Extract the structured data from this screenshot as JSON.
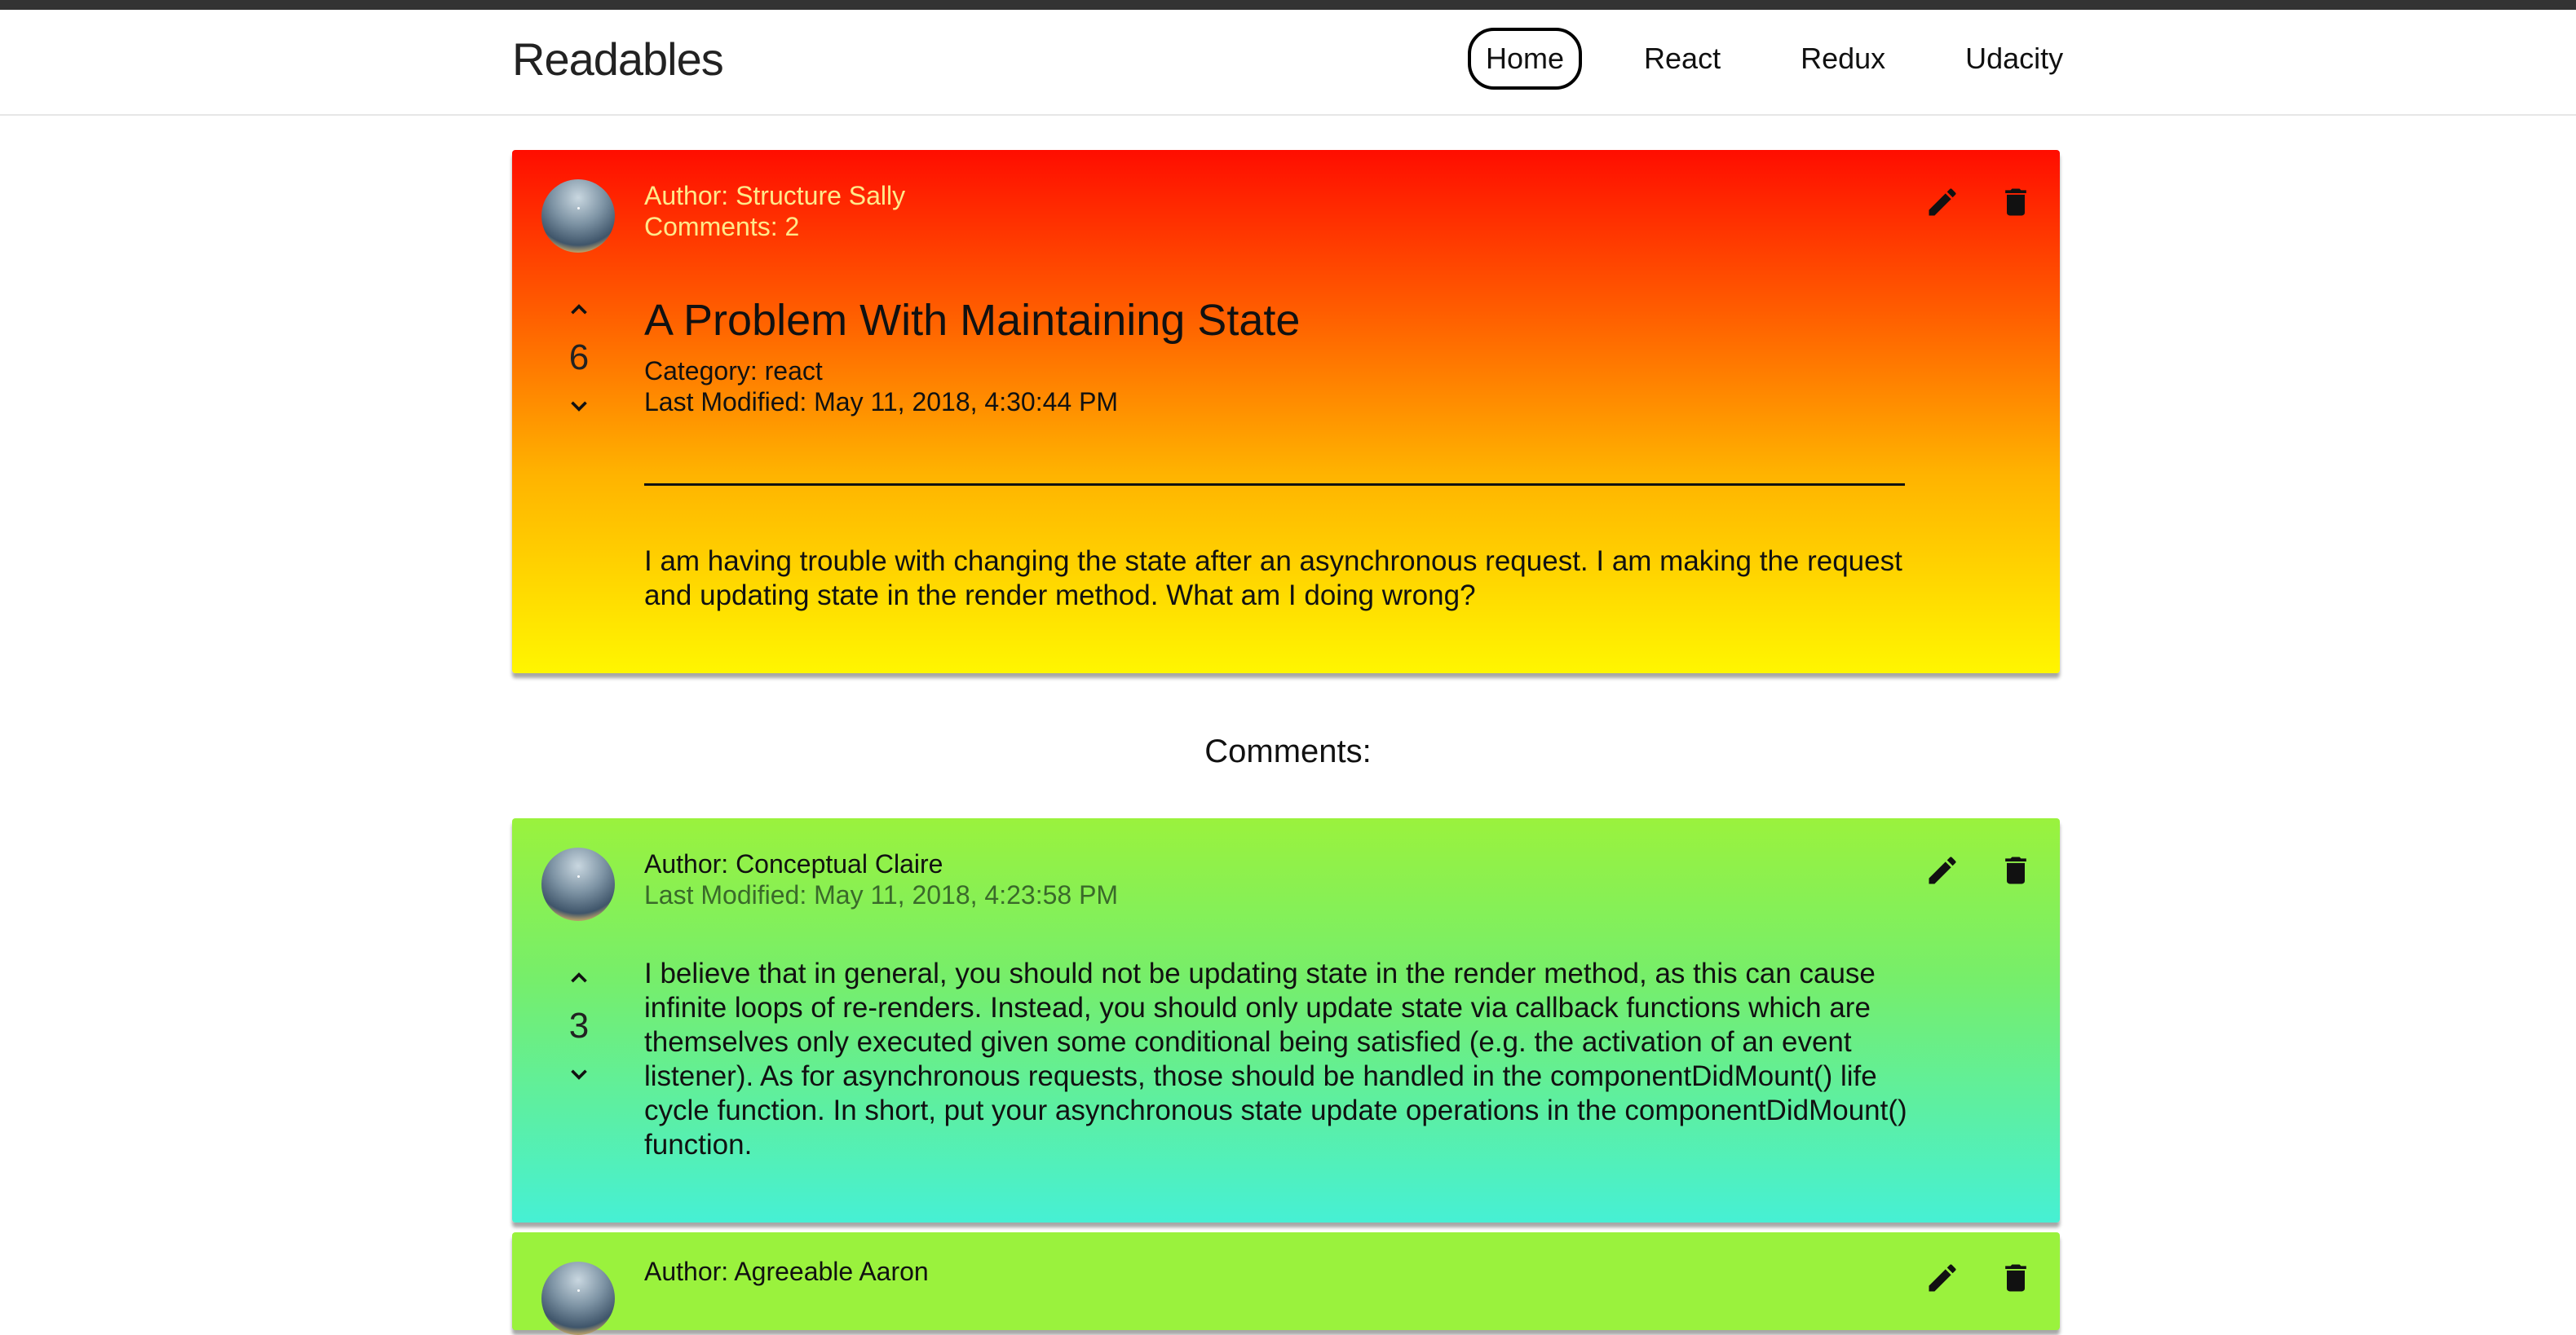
{
  "header": {
    "brand": "Readables",
    "nav": [
      {
        "label": "Home",
        "active": true
      },
      {
        "label": "React",
        "active": false
      },
      {
        "label": "Redux",
        "active": false
      },
      {
        "label": "Udacity",
        "active": false
      }
    ]
  },
  "post": {
    "author": "Author: Structure Sally",
    "comments_count": "Comments: 2",
    "score": "6",
    "title": "A Problem With Maintaining State",
    "category": "Category: react",
    "last_modified": "Last Modified: May 11, 2018, 4:30:44 PM",
    "body": "I am having trouble with changing the state after an asynchronous request. I am making the request and updating state in the render method. What am I doing wrong?"
  },
  "comments_heading": "Comments:",
  "comments": [
    {
      "author": "Author: Conceptual Claire",
      "last_modified": "Last Modified: May 11, 2018, 4:23:58 PM",
      "score": "3",
      "body": "I believe that in general, you should not be updating state in the render method, as this can cause infinite loops of re-renders. Instead, you should only update state via callback functions which are themselves only executed given some conditional being satisfied (e.g. the activation of an event listener). As for asynchronous requests, those should be handled in the componentDidMount() life cycle function. In short, put your asynchronous state update operations in the componentDidMount() function."
    },
    {
      "author": "Author: Agreeable Aaron"
    }
  ],
  "icons": {
    "edit": "pencil-icon",
    "delete": "trash-icon",
    "upvote": "chevron-up-icon",
    "downvote": "chevron-down-icon"
  },
  "colors": {
    "post_gradient": [
      "#ff0d00",
      "#fff600"
    ],
    "comment_gradient": [
      "#9af23d",
      "#46f0d4"
    ],
    "top_strip": "#333333"
  }
}
